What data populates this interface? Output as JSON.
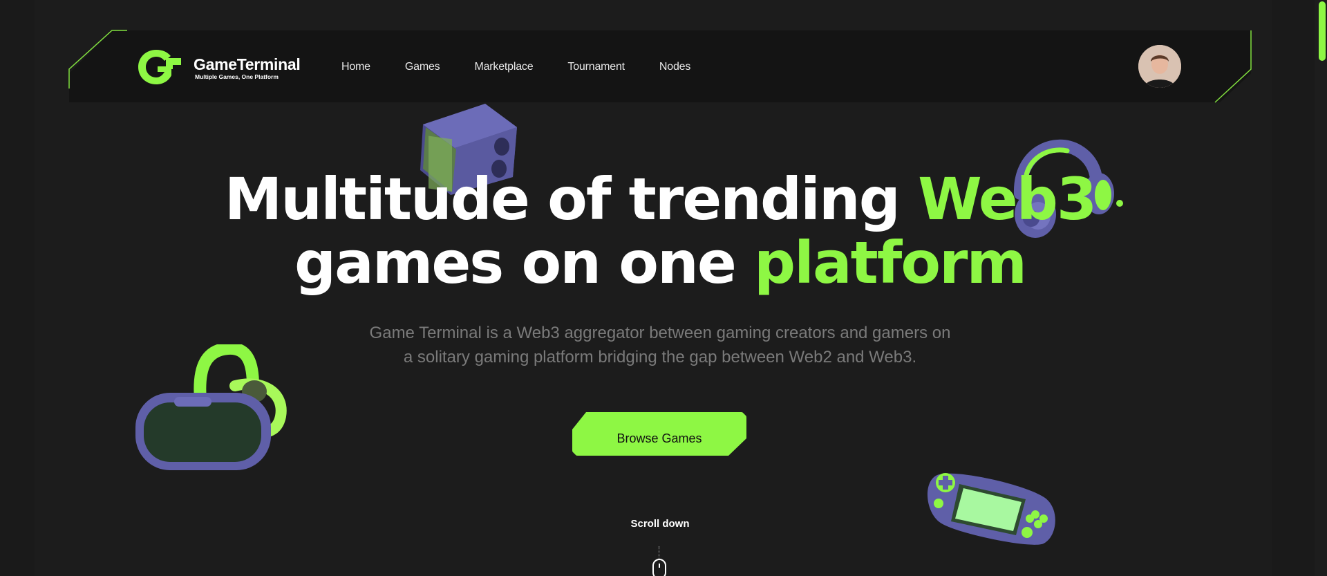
{
  "brand": {
    "name": "GameTerminal",
    "tagline": "Multiple Games, One Platform"
  },
  "nav": {
    "items": [
      "Home",
      "Games",
      "Marketplace",
      "Tournament",
      "Nodes"
    ]
  },
  "hero": {
    "headline_part1": "Multitude of trending ",
    "headline_highlight1": "Web3",
    "headline_part2": "games on one ",
    "headline_highlight2": "platform",
    "subtitle_line1": "Game Terminal is a Web3 aggregator between gaming creators and gamers on",
    "subtitle_line2": "a solitary gaming platform bridging the gap between Web2 and Web3.",
    "cta_label": "Browse Games",
    "scroll_label": "Scroll down"
  },
  "colors": {
    "accent": "#8ef744",
    "background": "#1a1a1a",
    "navbar": "#141414",
    "device_purple": "#5f5fa8"
  },
  "icons": [
    "logo-icon",
    "speaker-cube-icon",
    "headphones-icon",
    "vr-headset-icon",
    "gamepad-icon",
    "mouse-icon"
  ]
}
